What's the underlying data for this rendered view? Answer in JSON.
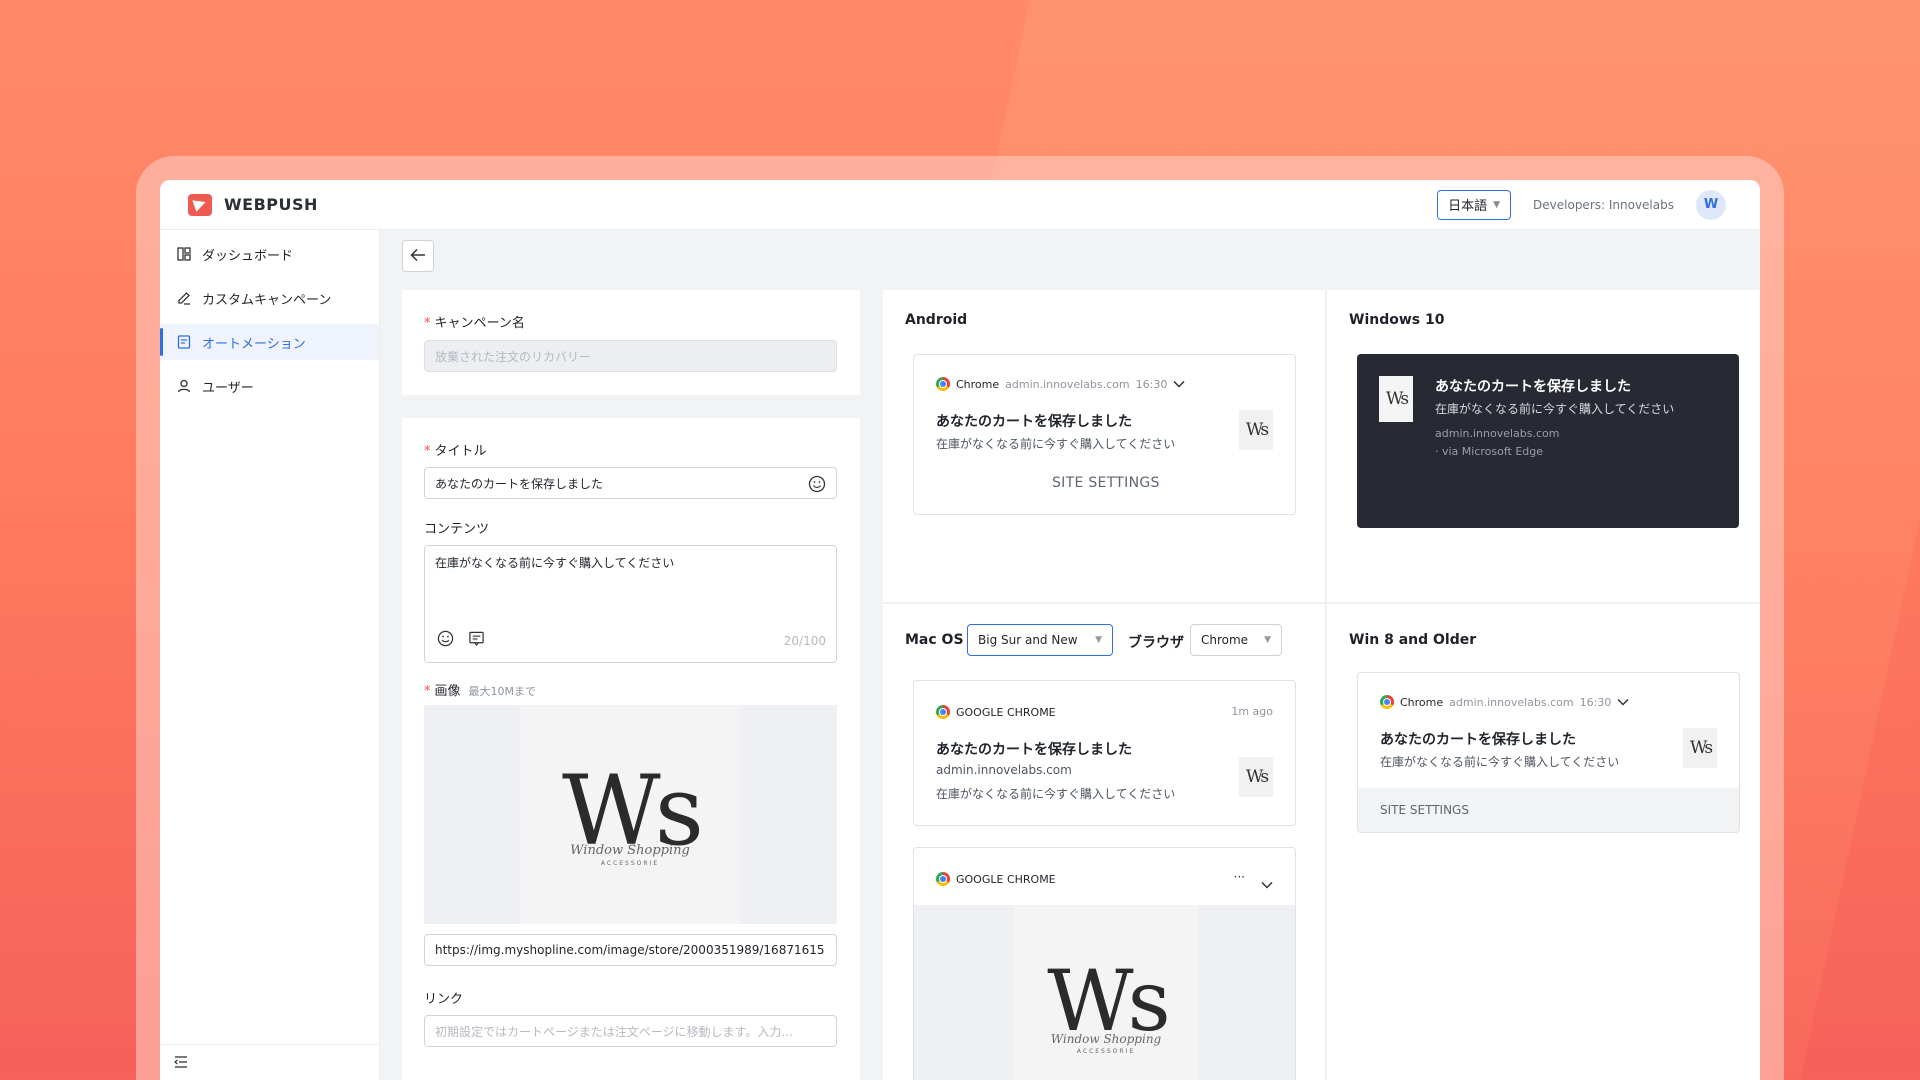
{
  "header": {
    "app_name": "WEBPUSH",
    "language": "日本語",
    "developers": "Developers: Innovelabs",
    "avatar_initial": "W"
  },
  "sidebar": {
    "items": [
      {
        "label": "ダッシュボード",
        "icon": "dashboard-icon"
      },
      {
        "label": "カスタムキャンペーン",
        "icon": "edit-icon"
      },
      {
        "label": "オートメーション",
        "icon": "automation-icon",
        "active": true
      },
      {
        "label": "ユーザー",
        "icon": "user-icon"
      }
    ]
  },
  "form": {
    "campaign_name_label": "キャンペーン名",
    "campaign_name_placeholder": "放棄された注文のリカバリー",
    "title_label": "タイトル",
    "title_value": "あなたのカートを保存しました",
    "content_label": "コンテンツ",
    "content_value": "在庫がなくなる前に今すぐ購入してください",
    "content_counter": "20/100",
    "image_label": "画像",
    "image_hint": "最大10Mまで",
    "image_url": "https://img.myshopline.com/image/store/2000351989/16871615",
    "link_label": "リンク",
    "link_placeholder": "初期設定ではカートページまたは注文ページに移動します。入力..."
  },
  "preview": {
    "notification_title": "あなたのカートを保存しました",
    "notification_body": "在庫がなくなる前に今すぐ購入してください",
    "domain": "admin.innovelabs.com",
    "time": "16:30",
    "browser_name": "Chrome",
    "site_settings_upper": "SITE SETTINGS",
    "site_settings": "SITE SETTINGS",
    "android_title": "Android",
    "windows10_title": "Windows 10",
    "via_edge": "· via Microsoft Edge",
    "macos_label": "Mac OS",
    "macos_version": "Big Sur and New",
    "browser_label": "ブラウザ",
    "browser_value": "Chrome",
    "google_chrome": "GOOGLE CHROME",
    "ago": "1m ago",
    "more": "···",
    "win8_title": "Win 8 and Older"
  },
  "image": {
    "logo_text": "Ws",
    "logo_script": "Window Shopping",
    "logo_sub": "ACCESSORIE"
  },
  "colors": {
    "accent": "#2f6fe0",
    "brand": "#ee5a52",
    "required": "#f54a45",
    "win10_bg": "#272a33"
  }
}
